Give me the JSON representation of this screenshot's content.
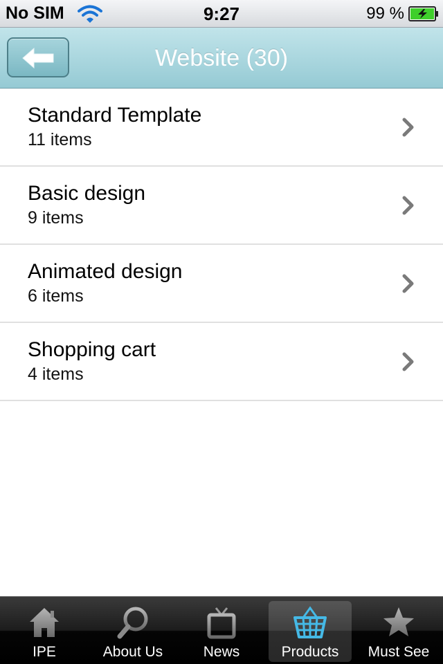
{
  "status_bar": {
    "carrier": "No SIM",
    "time": "9:27",
    "battery": "99 %"
  },
  "nav": {
    "title": "Website (30)",
    "back_icon": "back-arrow-icon"
  },
  "list": {
    "items": [
      {
        "title": "Standard Template",
        "count": "11 items"
      },
      {
        "title": "Basic design",
        "count": "9 items"
      },
      {
        "title": "Animated design",
        "count": "6 items"
      },
      {
        "title": "Shopping cart",
        "count": "4 items"
      }
    ]
  },
  "tabs": [
    {
      "label": "IPE",
      "icon": "home-icon",
      "active": false
    },
    {
      "label": "About Us",
      "icon": "magnifier-icon",
      "active": false
    },
    {
      "label": "News",
      "icon": "tv-icon",
      "active": false
    },
    {
      "label": "Products",
      "icon": "basket-icon",
      "active": true
    },
    {
      "label": "Must See",
      "icon": "star-icon",
      "active": false
    }
  ],
  "colors": {
    "nav_gradient_top": "#c1e4ea",
    "nav_gradient_bottom": "#95cad4",
    "active_tab_icon": "#45b9e6",
    "tab_icon_inactive": "#888888"
  }
}
